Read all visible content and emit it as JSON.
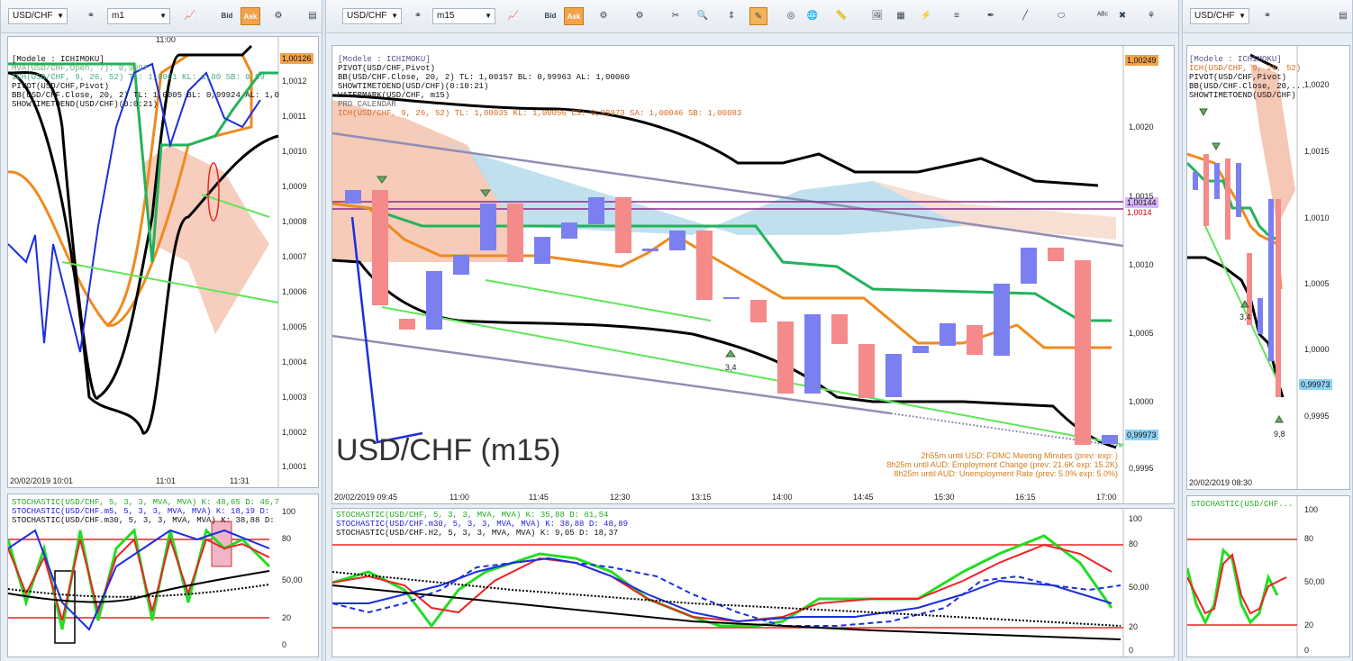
{
  "colors": {
    "bull": "#7b7ff0",
    "bear": "#f58a8a",
    "bb": "#000000",
    "kijun": "#f08a1e",
    "tenkan": "#22b35a",
    "trend": "#5ee65a",
    "channel": "#8f8fb5",
    "pivot": "#8b2a8b",
    "stoch_k": "#22dd22",
    "stoch_d": "#ee2222",
    "stoch_blue": "#1a2ee0"
  },
  "left": {
    "symbol": "USD/CHF",
    "timeframe": "m1",
    "bid": "Bid",
    "ask": "Ask",
    "time_top": "11:00",
    "legend": [
      "[Modele : ICHIMOKU]",
      "MVA(USD/CHF,Open, 7): 0,9997",
      "ICH(USD/CHF, 9, 26, 52) TL: 1,0001 KL: 1,00 SB: 0,99",
      "PIVOT(USD/CHF,Pivot)",
      "BB(USD/CHF.Close, 20, 2)  TL: 1,0005  BL: 0,99924  AL: 1,0",
      "SHOWTIMETOEND(USD/CHF)(0:0:21)"
    ],
    "price_tag": "1,00126",
    "yaxis": [
      "1,0012",
      "1,0011",
      "1,0010",
      "1,0009",
      "1,0008",
      "1,0007",
      "1,0006",
      "1,0005",
      "1,0004",
      "1,0003",
      "1,0002",
      "1,0001"
    ],
    "xaxis": [
      "20/02/2019 10:01",
      "11:01",
      "11:31"
    ],
    "stoch_legend": [
      "STOCHASTIC(USD/CHF, 5, 3, 3, MVA, MVA)  K: 48,65  D: 46,7",
      "STOCHASTIC(USD/CHF.m5, 5, 3, 3, MVA, MVA)  K: 18,19  D:",
      "STOCHASTIC(USD/CHF.m30, 5, 3, 3, MVA, MVA)  K: 38,88  D:"
    ],
    "stoch_axis": [
      "100",
      "80",
      "50,00",
      "20",
      "0"
    ]
  },
  "mid": {
    "symbol": "USD/CHF",
    "timeframe": "m15",
    "bid": "Bid",
    "ask": "Ask",
    "legend": [
      "[Modele : ICHIMOKU]",
      "PIVOT(USD/CHF,Pivot)",
      "BB(USD/CHF.Close, 20, 2)  TL: 1,00157  BL: 0,99963  AL: 1,00060",
      "SHOWTIMETOEND(USD/CHF)(0:10:21)",
      "WATERMARK(USD/CHF, m15)",
      "PRO CALENDAR",
      "ICH(USD/CHF, 9, 26, 52)  TL: 1,00035  KL: 1,00056  CS: 0,99973  SA: 1,00046  SB: 1,00083"
    ],
    "watermark": "USD/CHF (m15)",
    "price_tags": {
      "top": "1,00249",
      "pivot": "1,00144",
      "pivot_low": "1,0014",
      "last": "0,99973"
    },
    "yaxis": [
      "1,0020",
      "1,0015",
      "1,0010",
      "1,0005",
      "1,0000",
      "0,9995"
    ],
    "xaxis": [
      "20/02/2019 09:45",
      "11:00",
      "11:45",
      "12:30",
      "13:15",
      "14:00",
      "14:45",
      "15:30",
      "16:15",
      "17:00"
    ],
    "arrow_label": "3,4",
    "news": [
      "2h55m until USD: FOMC Meeting Minutes (prev:  exp: )",
      "8h25m until AUD: Employment Change (prev: 21.6K exp: 15.2K)",
      "8h25m until AUD: Unemployment Rate (prev: 5.0% exp: 5.0%)"
    ],
    "stoch_legend": [
      "STOCHASTIC(USD/CHF, 5, 3, 3, MVA, MVA)  K: 35,88  D: 61,54",
      "STOCHASTIC(USD/CHF.m30, 5, 3, 3, MVA, MVA)  K: 38,88  D: 48,89",
      "STOCHASTIC(USD/CHF.H2, 5, 3, 3, MVA, MVA)  K: 9,05  D: 18,37"
    ],
    "stoch_axis": [
      "100",
      "80",
      "50,00",
      "20",
      "0"
    ]
  },
  "right": {
    "symbol": "USD/CHF",
    "legend": [
      "[Modele : ICHIMOKU]",
      "ICH(USD/CHF, 9, 26, 52)",
      "PIVOT(USD/CHF,Pivot)",
      "BB(USD/CHF.Close, 20,...",
      "SHOWTIMETOEND(USD/CHF)"
    ],
    "yaxis": [
      "1,0020",
      "1,0015",
      "1,0010",
      "1,0005",
      "1,0000",
      "0,9995"
    ],
    "price_tag": "0,99973",
    "arrow_labels": [
      "3,4",
      "9,8"
    ],
    "xaxis": [
      "20/02/2019 08:30"
    ],
    "stoch_legend": [
      "STOCHASTIC(USD/CHF..."
    ],
    "stoch_axis": [
      "100",
      "80",
      "50,00",
      "20",
      "0"
    ]
  }
}
